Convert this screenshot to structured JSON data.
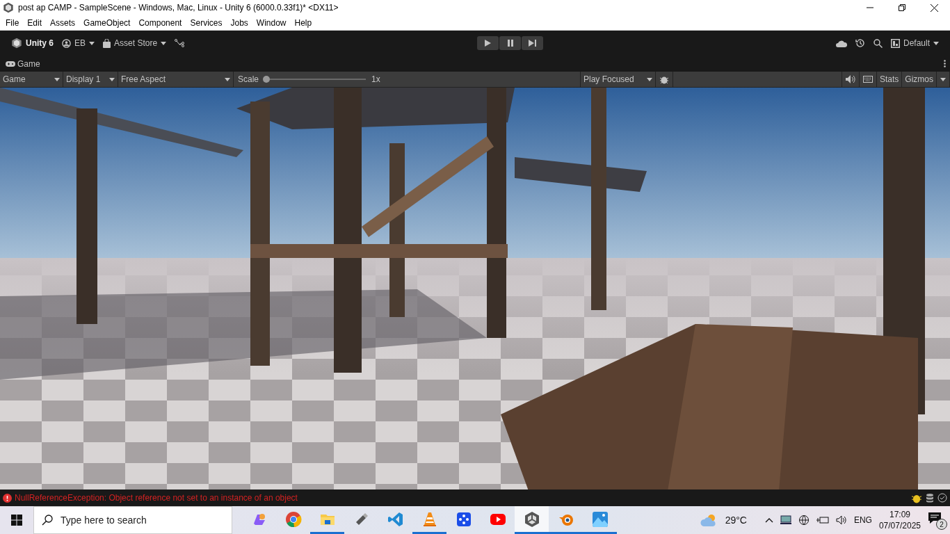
{
  "window": {
    "title": "post ap CAMP - SampleScene - Windows, Mac, Linux - Unity 6 (6000.0.33f1)* <DX11>"
  },
  "menu": [
    "File",
    "Edit",
    "Assets",
    "GameObject",
    "Component",
    "Services",
    "Jobs",
    "Window",
    "Help"
  ],
  "toolbar": {
    "product": "Unity 6",
    "account": "EB",
    "store": "Asset Store",
    "layout": "Default",
    "playing": false,
    "paused": false
  },
  "panel": {
    "tab": "Game"
  },
  "game_toolbar": {
    "view": "Game",
    "display": "Display 1",
    "aspect": "Free Aspect",
    "scale_label": "Scale",
    "scale": {
      "level": 0.02,
      "reading": "1x"
    },
    "play_mode": "Play Focused",
    "audio_muted": false,
    "stats": "Stats",
    "gizmos": "Gizmos"
  },
  "status": {
    "message": "NullReferenceException: Object reference not set to an instance of an object"
  },
  "taskbar": {
    "search": {
      "placeholder": "Type here to search"
    },
    "apps": [
      {
        "kind": "copilot",
        "running": false,
        "selected": false
      },
      {
        "kind": "chrome",
        "running": false,
        "selected": false
      },
      {
        "kind": "folder",
        "running": true,
        "selected": false
      },
      {
        "kind": "usb",
        "running": false,
        "selected": false
      },
      {
        "kind": "code",
        "running": false,
        "selected": false
      },
      {
        "kind": "cone",
        "running": true,
        "selected": false
      },
      {
        "kind": "dice",
        "running": false,
        "selected": false
      },
      {
        "kind": "video",
        "running": false,
        "selected": false
      },
      {
        "kind": "unity",
        "running": true,
        "selected": true
      },
      {
        "kind": "blender",
        "running": true,
        "selected": false
      },
      {
        "kind": "photos",
        "running": true,
        "selected": false
      }
    ],
    "weather": "29°C",
    "language": "ENG",
    "time": "17:09",
    "date": "07/07/2025",
    "notifications": "2"
  }
}
